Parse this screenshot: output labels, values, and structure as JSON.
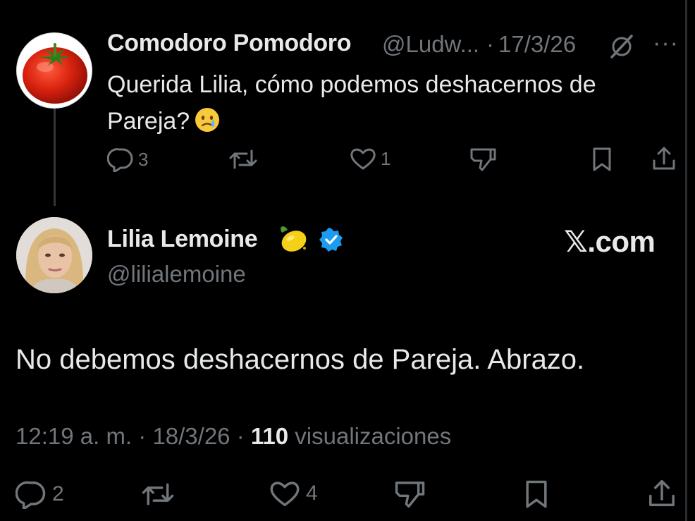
{
  "reply_tweet": {
    "display_name": "Comodoro Pomodoro",
    "handle": "@Ludw...",
    "separator": "·",
    "date": "17/3/26",
    "more": "···",
    "text_line1": "Querida Lilia, cómo podemos deshacernos de",
    "text_line2": "Pareja?",
    "actions": {
      "replies": "3",
      "retweets": "",
      "likes": "1"
    }
  },
  "main_tweet": {
    "display_name": "Lilia Lemoine",
    "handle": "@lilialemoine",
    "watermark": "𝕏.com",
    "text": "No debemos deshacernos de Pareja. Abrazo.",
    "time": "12:19 a. m.",
    "sep1": " · ",
    "date": "18/3/26",
    "sep2": " · ",
    "views_count": "110",
    "views_label": "visualizaciones",
    "actions": {
      "replies": "2",
      "retweets": "",
      "likes": "4"
    }
  },
  "colors": {
    "background": "#000000",
    "text": "#e7e9ea",
    "muted": "#71767b",
    "verified": "#1d9bf0"
  },
  "icons": [
    "tomato-avatar",
    "lilia-avatar",
    "grok-icon",
    "tear-emoji",
    "lemon-emoji",
    "verified-badge-icon",
    "reply-icon",
    "retweet-icon",
    "like-icon",
    "dislike-icon",
    "bookmark-icon",
    "share-icon"
  ]
}
